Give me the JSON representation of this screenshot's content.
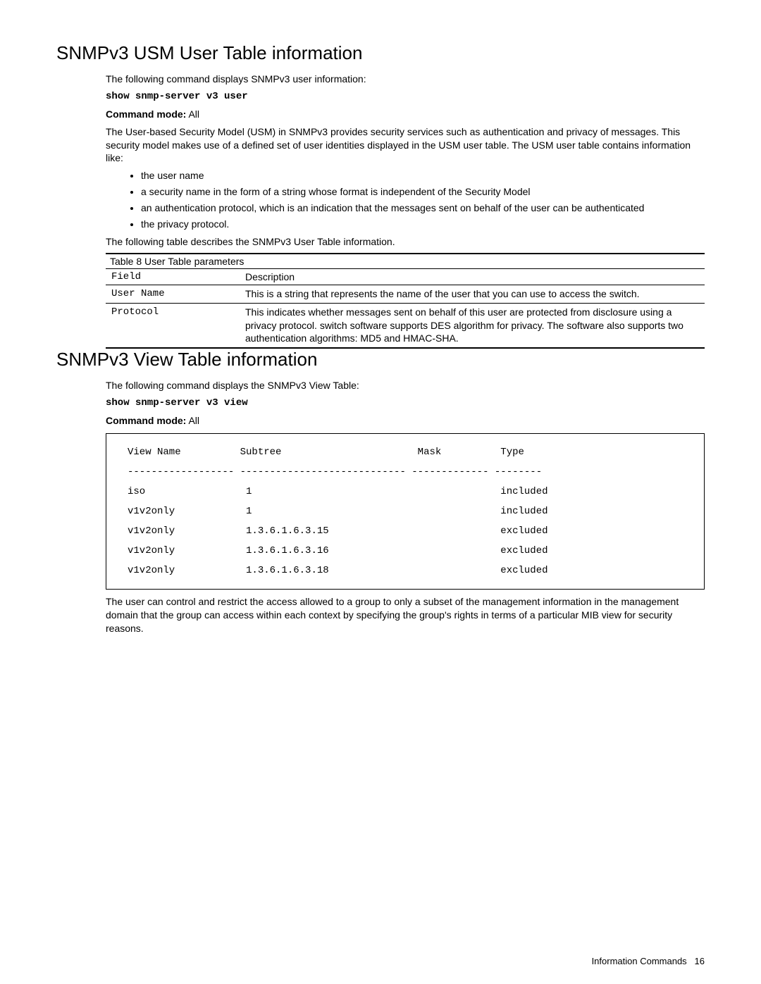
{
  "section1": {
    "title": "SNMPv3 USM User Table information",
    "intro": "The following command displays SNMPv3 user information:",
    "command": "show snmp-server v3 user",
    "modeLabel": "Command mode:",
    "modeValue": " All",
    "para1": "The User-based Security Model (USM) in SNMPv3 provides security services such as authentication and privacy of messages. This security model makes use of a defined set of user identities displayed in the USM user table. The USM user table contains information like:",
    "bullets": [
      "the user name",
      "a security name in the form of a string whose format is independent of the Security Model",
      "an authentication protocol, which is an indication that the messages sent on behalf of the user can be authenticated",
      "the privacy protocol."
    ],
    "para2": "The following table describes the SNMPv3 User Table information.",
    "tableCaption": "Table 8  User Table parameters",
    "tableHeaders": {
      "field": "Field",
      "desc": "Description"
    },
    "tableRows": [
      {
        "field": "User Name",
        "desc": "This is a string that represents the name of the user that you can use to access the switch."
      },
      {
        "field": "Protocol",
        "desc": "This indicates whether messages sent on behalf of this user are protected from disclosure using a privacy protocol. switch software supports DES algorithm for privacy. The software also supports two authentication algorithms: MD5 and HMAC-SHA."
      }
    ]
  },
  "section2": {
    "title": "SNMPv3 View Table information",
    "intro": "The following command displays the SNMPv3 View Table:",
    "command": "show snmp-server v3 view",
    "modeLabel": "Command mode:",
    "modeValue": " All",
    "preText": "View Name          Subtree                       Mask          Type\n------------------ ---------------------------- ------------- --------\niso                 1                                          included\nv1v2only            1                                          included\nv1v2only            1.3.6.1.6.3.15                             excluded\nv1v2only            1.3.6.1.6.3.16                             excluded\nv1v2only            1.3.6.1.6.3.18                             excluded",
    "para1": "The user can control and restrict the access allowed to a group to only a subset of the management information in the management domain that the group can access within each context by specifying the group's rights in terms of a particular MIB view for security reasons."
  },
  "footer": {
    "label": "Information Commands",
    "page": "16"
  }
}
